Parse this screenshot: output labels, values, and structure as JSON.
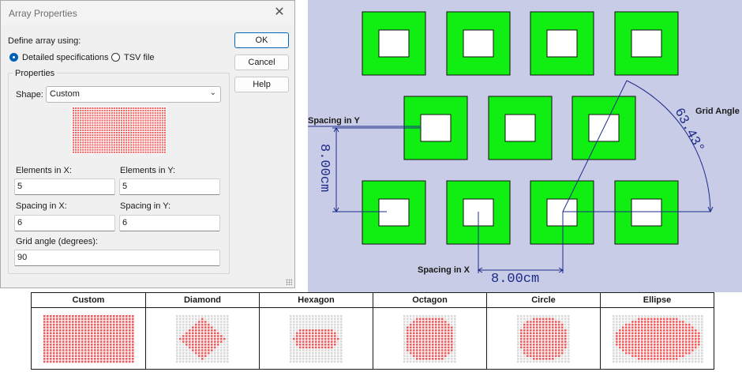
{
  "dialog": {
    "title": "Array Properties",
    "define_label": "Define array using:",
    "radio_detailed": "Detailed specifications",
    "radio_tsv": "TSV file",
    "selected_mode": "detailed",
    "group_title": "Properties",
    "shape_label": "Shape:",
    "shape_value": "Custom",
    "elements_x_label": "Elements in X:",
    "elements_x_value": "5",
    "elements_y_label": "Elements in Y:",
    "elements_y_value": "5",
    "spacing_x_label": "Spacing in X:",
    "spacing_x_value": "6",
    "spacing_y_label": "Spacing in Y:",
    "spacing_y_value": "6",
    "grid_angle_label": "Grid angle (degrees):",
    "grid_angle_value": "90",
    "ok_label": "OK",
    "cancel_label": "Cancel",
    "help_label": "Help"
  },
  "diagram": {
    "spacing_y_label": "Spacing in Y",
    "spacing_x_label": "Spacing in X",
    "grid_angle_label": "Grid Angle",
    "dim_y": "8.00cm",
    "dim_x": "8.00cm",
    "angle_value": "63.43°"
  },
  "shapes_table": {
    "headers": [
      "Custom",
      "Diamond",
      "Hexagon",
      "Octagon",
      "Circle",
      "Ellipse"
    ]
  },
  "colors": {
    "accent": "#0067c0",
    "element_green": "#11ee11",
    "dim_blue": "#1c2b8a",
    "dot_red": "#f05a5a",
    "dot_grey": "#d8d8d8",
    "diagram_bg": "#c9cce6"
  }
}
